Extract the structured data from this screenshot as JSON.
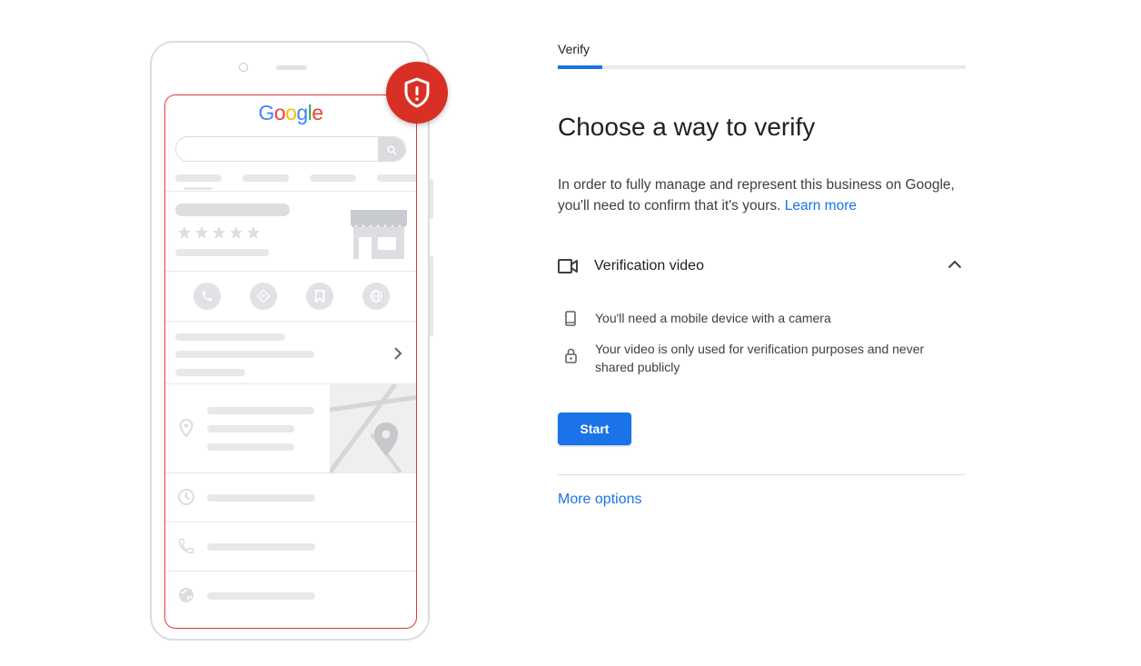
{
  "illustration": {
    "logo_letters": [
      {
        "ch": "G",
        "color": "#4285f4"
      },
      {
        "ch": "o",
        "color": "#ea4335"
      },
      {
        "ch": "o",
        "color": "#fbbc05"
      },
      {
        "ch": "g",
        "color": "#4285f4"
      },
      {
        "ch": "l",
        "color": "#34a853"
      },
      {
        "ch": "e",
        "color": "#ea4335"
      }
    ],
    "badge_icon": "shield-alert-icon",
    "badge_color": "#d93025",
    "outline_color": "#e53935"
  },
  "verify": {
    "tab_label": "Verify",
    "progress_fraction": 0.11,
    "accent_color": "#1a73e8",
    "title": "Choose a way to verify",
    "description": "In order to fully manage and represent this business on Google, you'll need to confirm that it's yours.",
    "learn_more": "Learn more",
    "method": {
      "title": "Verification video",
      "icon": "video-camera-icon",
      "expand_icon": "chevron-up-icon",
      "requirements": [
        {
          "icon": "phone-icon",
          "text": "You'll need a mobile device with a camera"
        },
        {
          "icon": "lock-icon",
          "text": "Your video is only used for verification purposes and never shared publicly"
        }
      ]
    },
    "start_label": "Start",
    "more_options": "More options"
  }
}
